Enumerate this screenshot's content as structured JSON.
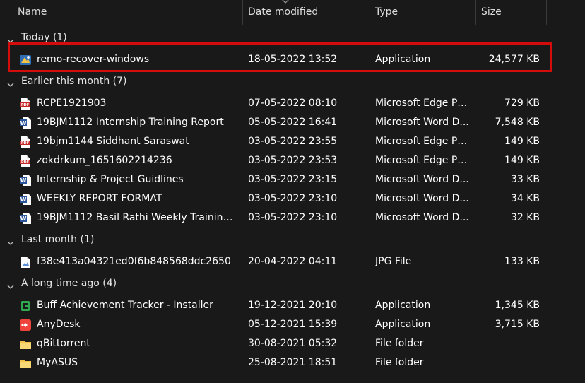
{
  "columns": {
    "name": "Name",
    "date": "Date modified",
    "type": "Type",
    "size": "Size"
  },
  "groups": [
    {
      "label": "Today (1)",
      "files": [
        {
          "name": "remo-recover-windows",
          "date": "18-05-2022 13:52",
          "type": "Application",
          "size": "24,577 KB",
          "icon": "remo-app-icon"
        }
      ]
    },
    {
      "label": "Earlier this month (7)",
      "files": [
        {
          "name": "RCPE1921903",
          "date": "07-05-2022 08:10",
          "type": "Microsoft Edge PD...",
          "size": "729 KB",
          "icon": "pdf-icon"
        },
        {
          "name": "19BJM1112 Internship Training Report",
          "date": "05-05-2022 16:41",
          "type": "Microsoft Word D...",
          "size": "7,548 KB",
          "icon": "word-icon"
        },
        {
          "name": "19bjm1144 Siddhant Saraswat",
          "date": "03-05-2022 23:55",
          "type": "Microsoft Edge PD...",
          "size": "149 KB",
          "icon": "pdf-icon"
        },
        {
          "name": "zokdrkum_1651602214236",
          "date": "03-05-2022 23:53",
          "type": "Microsoft Edge PD...",
          "size": "149 KB",
          "icon": "pdf-icon"
        },
        {
          "name": "Internship & Project Guidlines",
          "date": "03-05-2022 23:15",
          "type": "Microsoft Word D...",
          "size": "33 KB",
          "icon": "word-icon"
        },
        {
          "name": "WEEKLY REPORT FORMAT",
          "date": "03-05-2022 23:10",
          "type": "Microsoft Word D...",
          "size": "34 KB",
          "icon": "word-icon"
        },
        {
          "name": "19BJM1112 Basil Rathi Weekly Training R...",
          "date": "03-05-2022 23:10",
          "type": "Microsoft Word D...",
          "size": "32 KB",
          "icon": "word-icon"
        }
      ]
    },
    {
      "label": "Last month (1)",
      "files": [
        {
          "name": "f38e413a04321ed0f6b848568ddc2650",
          "date": "20-04-2022 04:11",
          "type": "JPG File",
          "size": "133 KB",
          "icon": "image-file-icon"
        }
      ]
    },
    {
      "label": "A long time ago (4)",
      "files": [
        {
          "name": "Buff Achievement Tracker - Installer",
          "date": "19-12-2021 20:10",
          "type": "Application",
          "size": "1,345 KB",
          "icon": "buff-app-icon"
        },
        {
          "name": "AnyDesk",
          "date": "05-12-2021 15:39",
          "type": "Application",
          "size": "3,715 KB",
          "icon": "anydesk-icon"
        },
        {
          "name": "qBittorrent",
          "date": "30-08-2021 05:32",
          "type": "File folder",
          "size": "",
          "icon": "folder-icon"
        },
        {
          "name": "MyASUS",
          "date": "25-08-2021 18:51",
          "type": "File folder",
          "size": "",
          "icon": "folder-icon"
        }
      ]
    }
  ],
  "colors": {
    "background": "#191919",
    "highlight": "#d40c0c",
    "pdf": "#c62828",
    "word": "#2b579a",
    "folder": "#f3c24b"
  }
}
